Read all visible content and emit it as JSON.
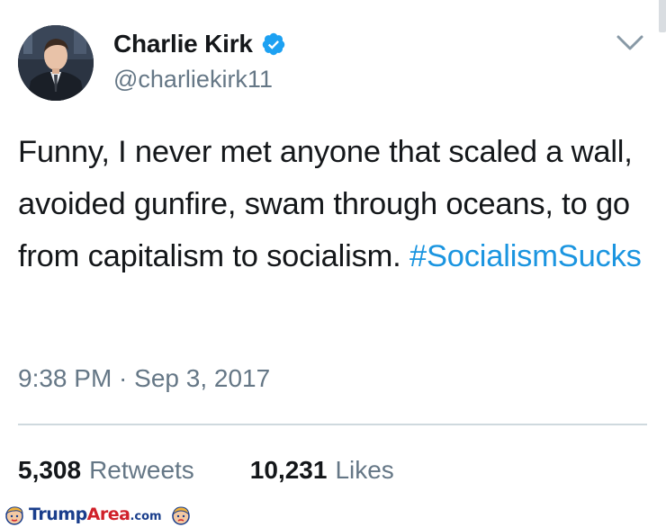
{
  "tweet": {
    "author": {
      "display_name": "Charlie Kirk",
      "handle": "@charliekirk11",
      "verified": true
    },
    "text": "Funny, I never met anyone that scaled a wall, avoided gunfire, swam through oceans, to go from capitalism to socialism.",
    "hashtag": "#SocialismSucks",
    "timestamp": "9:38 PM · Sep 3, 2017",
    "stats": {
      "retweets_count": "5,308",
      "retweets_label": "Retweets",
      "likes_count": "10,231",
      "likes_label": "Likes"
    }
  },
  "watermark": {
    "brand_prefix": "Trump",
    "brand_suffix": "Area",
    "domain": ".com"
  },
  "icons": {
    "verified": "verified-badge-icon",
    "menu": "chevron-down-icon",
    "watermark": "cartoon-face-icon"
  },
  "colors": {
    "text": "#14171a",
    "secondary": "#657786",
    "link": "#1b95e0",
    "verified": "#1da1f2",
    "divider": "#cfd9de",
    "watermark_blue": "#1a3e8c",
    "watermark_red": "#d0212a"
  }
}
